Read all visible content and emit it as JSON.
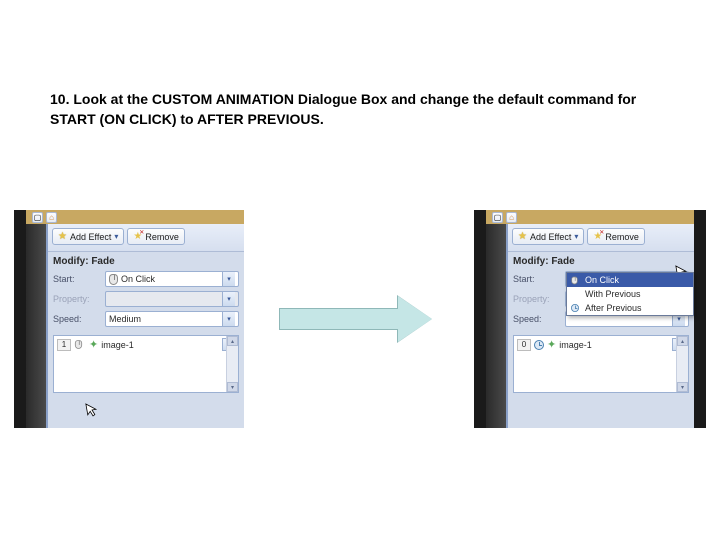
{
  "instruction": "10. Look at the CUSTOM ANIMATION Dialogue Box and change the default command for START (ON CLICK) to AFTER PREVIOUS.",
  "left_panel": {
    "add_effect_label": "Add Effect",
    "remove_label": "Remove",
    "section_title": "Modify: Fade",
    "start_label": "Start:",
    "start_value": "On Click",
    "property_label": "Property:",
    "property_value": "",
    "speed_label": "Speed:",
    "speed_value": "Medium",
    "list_item_seq": "1",
    "list_item_name": "image-1"
  },
  "right_panel": {
    "add_effect_label": "Add Effect",
    "remove_label": "Remove",
    "section_title": "Modify: Fade",
    "start_label": "Start:",
    "start_value": "After Previous",
    "property_label": "Property:",
    "speed_label": "Speed:",
    "dropdown_options": {
      "opt1": "On Click",
      "opt2": "With Previous",
      "opt3": "After Previous"
    },
    "list_item_seq": "0",
    "list_item_name": "image-1"
  }
}
